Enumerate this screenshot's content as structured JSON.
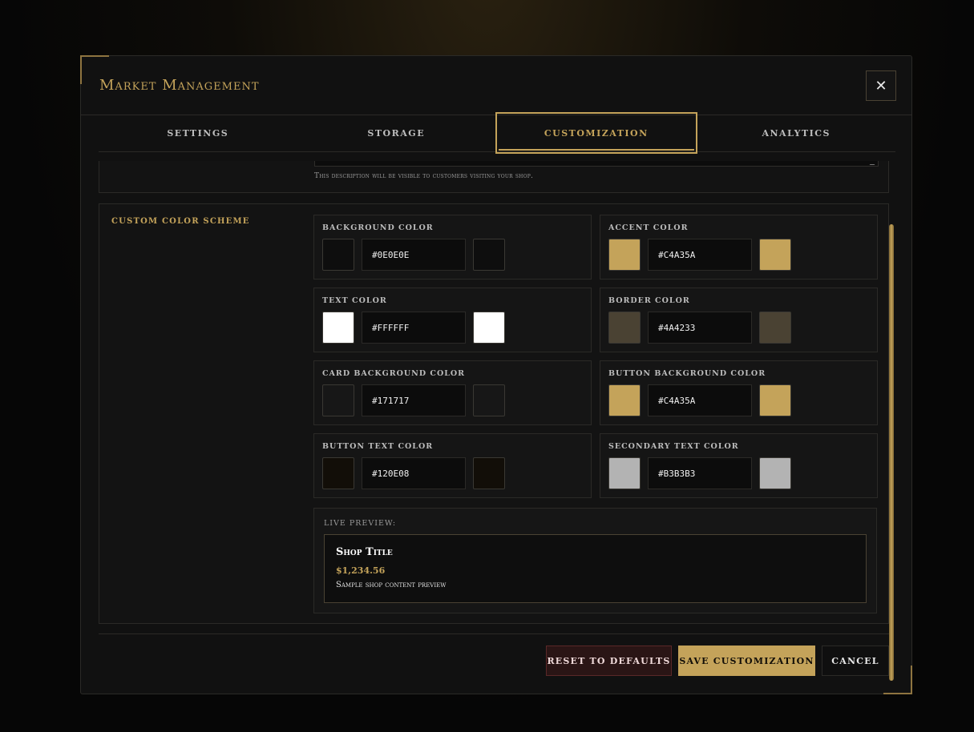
{
  "modal": {
    "title": "Market Management",
    "close_symbol": "✕"
  },
  "tabs": [
    {
      "label": "Settings",
      "active": false
    },
    {
      "label": "Storage",
      "active": false
    },
    {
      "label": "Customization",
      "active": true
    },
    {
      "label": "Analytics",
      "active": false
    }
  ],
  "description": {
    "hint": "This description will be visible to customers visiting your shop."
  },
  "color_scheme": {
    "section_label": "Custom Color Scheme",
    "fields": [
      {
        "label": "Background Color",
        "value": "#0E0E0E",
        "color": "#0e0e0e"
      },
      {
        "label": "Accent Color",
        "value": "#C4A35A",
        "color": "#c4a35a"
      },
      {
        "label": "Text Color",
        "value": "#FFFFFF",
        "color": "#ffffff"
      },
      {
        "label": "Border Color",
        "value": "#4A4233",
        "color": "#4a4233"
      },
      {
        "label": "Card Background Color",
        "value": "#171717",
        "color": "#171717"
      },
      {
        "label": "Button Background Color",
        "value": "#C4A35A",
        "color": "#c4a35a"
      },
      {
        "label": "Button Text Color",
        "value": "#120E08",
        "color": "#120e08"
      },
      {
        "label": "Secondary Text Color",
        "value": "#B3B3B3",
        "color": "#b3b3b3"
      }
    ]
  },
  "live_preview": {
    "label": "Live Preview:",
    "shop_title": "Shop Title",
    "price": "$1,234.56",
    "sample_text": "Sample shop content preview"
  },
  "footer": {
    "reset_label": "Reset to Defaults",
    "save_label": "Save Customization",
    "cancel_label": "Cancel"
  }
}
